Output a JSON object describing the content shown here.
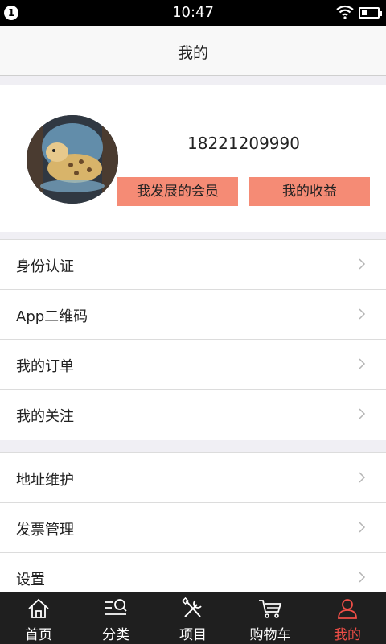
{
  "status_bar": {
    "time": "10:47",
    "notification_count": "1"
  },
  "header": {
    "title": "我的"
  },
  "profile": {
    "phone": "18221209990",
    "buttons": {
      "members": "我发展的会员",
      "earnings": "我的收益"
    },
    "button_color": "#f58b75"
  },
  "menu_group_1": [
    {
      "label": "身份认证"
    },
    {
      "label": "App二维码"
    },
    {
      "label": "我的订单"
    },
    {
      "label": "我的关注"
    }
  ],
  "menu_group_2": [
    {
      "label": "地址维护"
    },
    {
      "label": "发票管理"
    },
    {
      "label": "设置"
    }
  ],
  "tabbar": {
    "tabs": [
      {
        "label": "首页",
        "icon": "home-icon"
      },
      {
        "label": "分类",
        "icon": "category-search-icon"
      },
      {
        "label": "项目",
        "icon": "tools-icon"
      },
      {
        "label": "购物车",
        "icon": "cart-icon"
      },
      {
        "label": "我的",
        "icon": "user-icon"
      }
    ],
    "active_index": 4,
    "active_color": "#ef4e47"
  }
}
